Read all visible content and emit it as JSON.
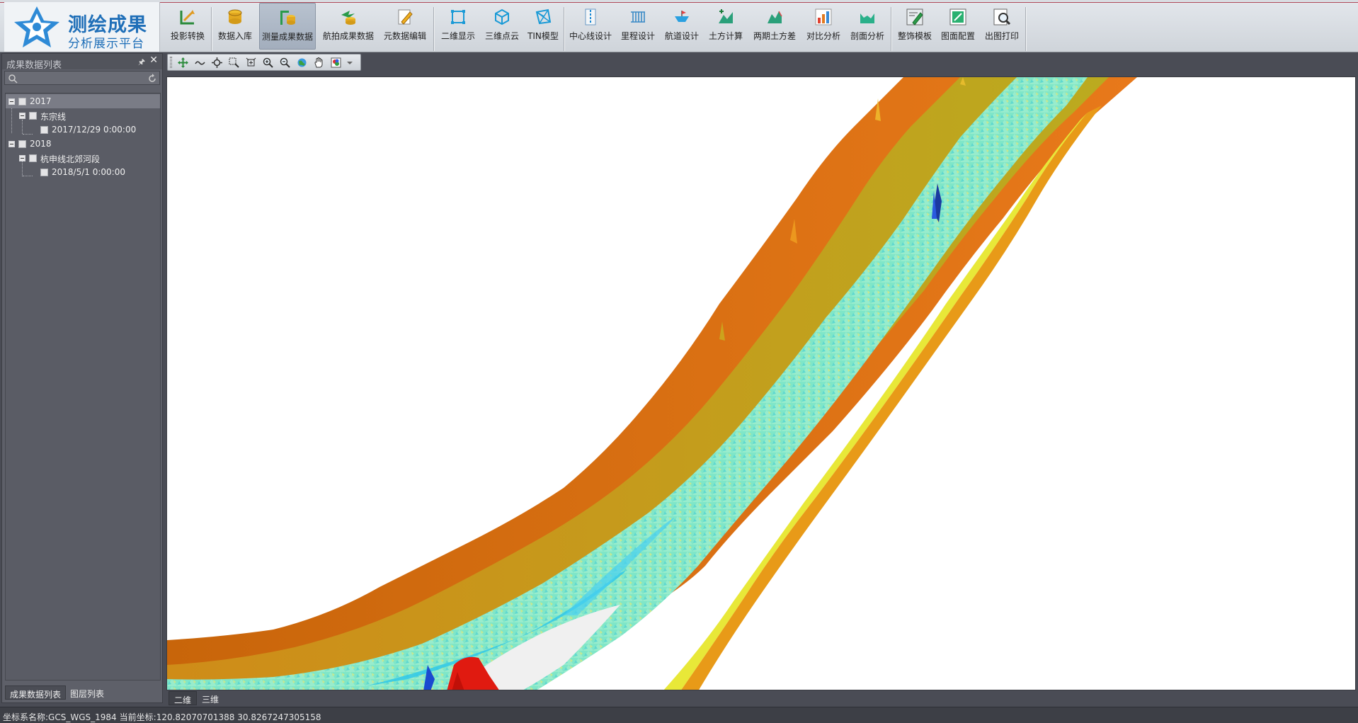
{
  "app": {
    "title_line1": "测绘成果",
    "title_line2": "分析展示平台"
  },
  "toolbar": {
    "items": [
      {
        "label": "投影转换",
        "icon": "projection-icon"
      },
      {
        "label": "数据入库",
        "icon": "database-import-icon"
      },
      {
        "label": "测量成果数据",
        "icon": "survey-data-icon"
      },
      {
        "label": "航拍成果数据",
        "icon": "aerial-data-icon"
      },
      {
        "label": "元数据编辑",
        "icon": "metadata-edit-icon"
      },
      {
        "label": "二维显示",
        "icon": "2d-display-icon"
      },
      {
        "label": "三维点云",
        "icon": "point-cloud-icon"
      },
      {
        "label": "TIN模型",
        "icon": "tin-model-icon"
      },
      {
        "label": "中心线设计",
        "icon": "centerline-icon"
      },
      {
        "label": "里程设计",
        "icon": "mileage-icon"
      },
      {
        "label": "航道设计",
        "icon": "channel-icon"
      },
      {
        "label": "土方计算",
        "icon": "earthwork-icon"
      },
      {
        "label": "两期土方差",
        "icon": "earthwork-diff-icon"
      },
      {
        "label": "对比分析",
        "icon": "compare-chart-icon"
      },
      {
        "label": "剖面分析",
        "icon": "profile-icon"
      },
      {
        "label": "整饰模板",
        "icon": "template-icon"
      },
      {
        "label": "图面配置",
        "icon": "layout-config-icon"
      },
      {
        "label": "出图打印",
        "icon": "print-icon"
      }
    ],
    "active_index": 2
  },
  "left_panel": {
    "title": "成果数据列表",
    "search_placeholder": "",
    "tree": [
      {
        "label": "2017",
        "level": 0
      },
      {
        "label": "东宗线",
        "level": 1
      },
      {
        "label": "2017/12/29 0:00:00",
        "level": 2
      },
      {
        "label": "2018",
        "level": 0
      },
      {
        "label": "杭申线北郊河段",
        "level": 1
      },
      {
        "label": "2018/5/1 0:00:00",
        "level": 2
      }
    ],
    "tabs": [
      "成果数据列表",
      "图层列表"
    ]
  },
  "map_tools": [
    "pan-icon",
    "measure-icon",
    "full-extent-icon",
    "zoom-box-in-icon",
    "zoom-box-out-icon",
    "zoom-in-icon",
    "zoom-out-icon",
    "globe-icon",
    "hand-icon",
    "color-icon"
  ],
  "view_tabs": [
    "二维",
    "三维"
  ],
  "status": {
    "crs": "坐标系名称:GCS_WGS_1984",
    "coords": "当前坐标:120.82070701388 30.8267247305158"
  }
}
